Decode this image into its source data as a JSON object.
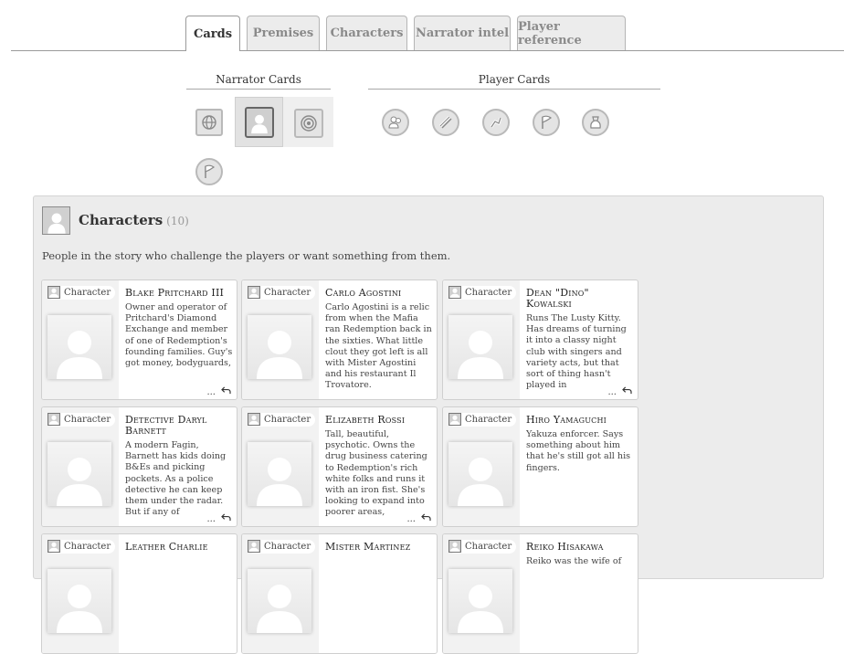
{
  "tabs": [
    {
      "label": "Cards",
      "active": true
    },
    {
      "label": "Premises",
      "active": false
    },
    {
      "label": "Characters",
      "active": false
    },
    {
      "label": "Narrator intel",
      "active": false
    },
    {
      "label": "Player reference",
      "active": false
    }
  ],
  "narrator_cards": {
    "heading": "Narrator Cards",
    "icons": [
      "globe-icon",
      "character-icon",
      "target-icon",
      "flag-icon"
    ],
    "selected": "character-icon"
  },
  "player_cards": {
    "heading": "Player Cards",
    "icons": [
      "people-icon",
      "slash-icon",
      "gesture-icon",
      "flag-icon",
      "bag-icon"
    ]
  },
  "panel": {
    "title": "Characters",
    "count": "(10)",
    "description": "People in the story who challenge the players or want something from them."
  },
  "card_tag_label": "Character",
  "more_label": "...",
  "cards": [
    {
      "name": "Blake Pritchard III",
      "desc": "Owner and operator of Pritchard's Diamond Exchange and member of one of Redemption's founding families. Guy's got money, bodyguards,",
      "more": true
    },
    {
      "name": "Carlo Agostini",
      "desc": "Carlo Agostini is a relic from when the Mafia ran Redemption back in the sixties. What little clout they got left is all with Mister Agostini and his restaurant Il Trovatore.",
      "more": false
    },
    {
      "name": "Dean \"Dino\" Kowalski",
      "desc": "Runs The Lusty Kitty. Has dreams of turning it into a classy night club with singers and variety acts, but that sort of thing hasn't played in",
      "more": true
    },
    {
      "name": "Detective Daryl Barnett",
      "desc": "A modern Fagin, Barnett has kids doing B&Es and picking pockets. As a police detective he can keep them under the radar. But if any of",
      "more": true
    },
    {
      "name": "Elizabeth Rossi",
      "desc": "Tall, beautiful, psychotic. Owns the drug business catering to Redemption's rich white folks and runs it with an iron fist. She's looking to expand into poorer areas,",
      "more": true
    },
    {
      "name": "Hiro Yamaguchi",
      "desc": "Yakuza enforcer. Says something about him that he's still got all his fingers.",
      "more": false
    },
    {
      "name": "Leather Charlie",
      "desc": "",
      "more": false
    },
    {
      "name": "Mister Martinez",
      "desc": "",
      "more": false
    },
    {
      "name": "Reiko Hisakawa",
      "desc": "Reiko was the wife of",
      "more": false
    }
  ]
}
